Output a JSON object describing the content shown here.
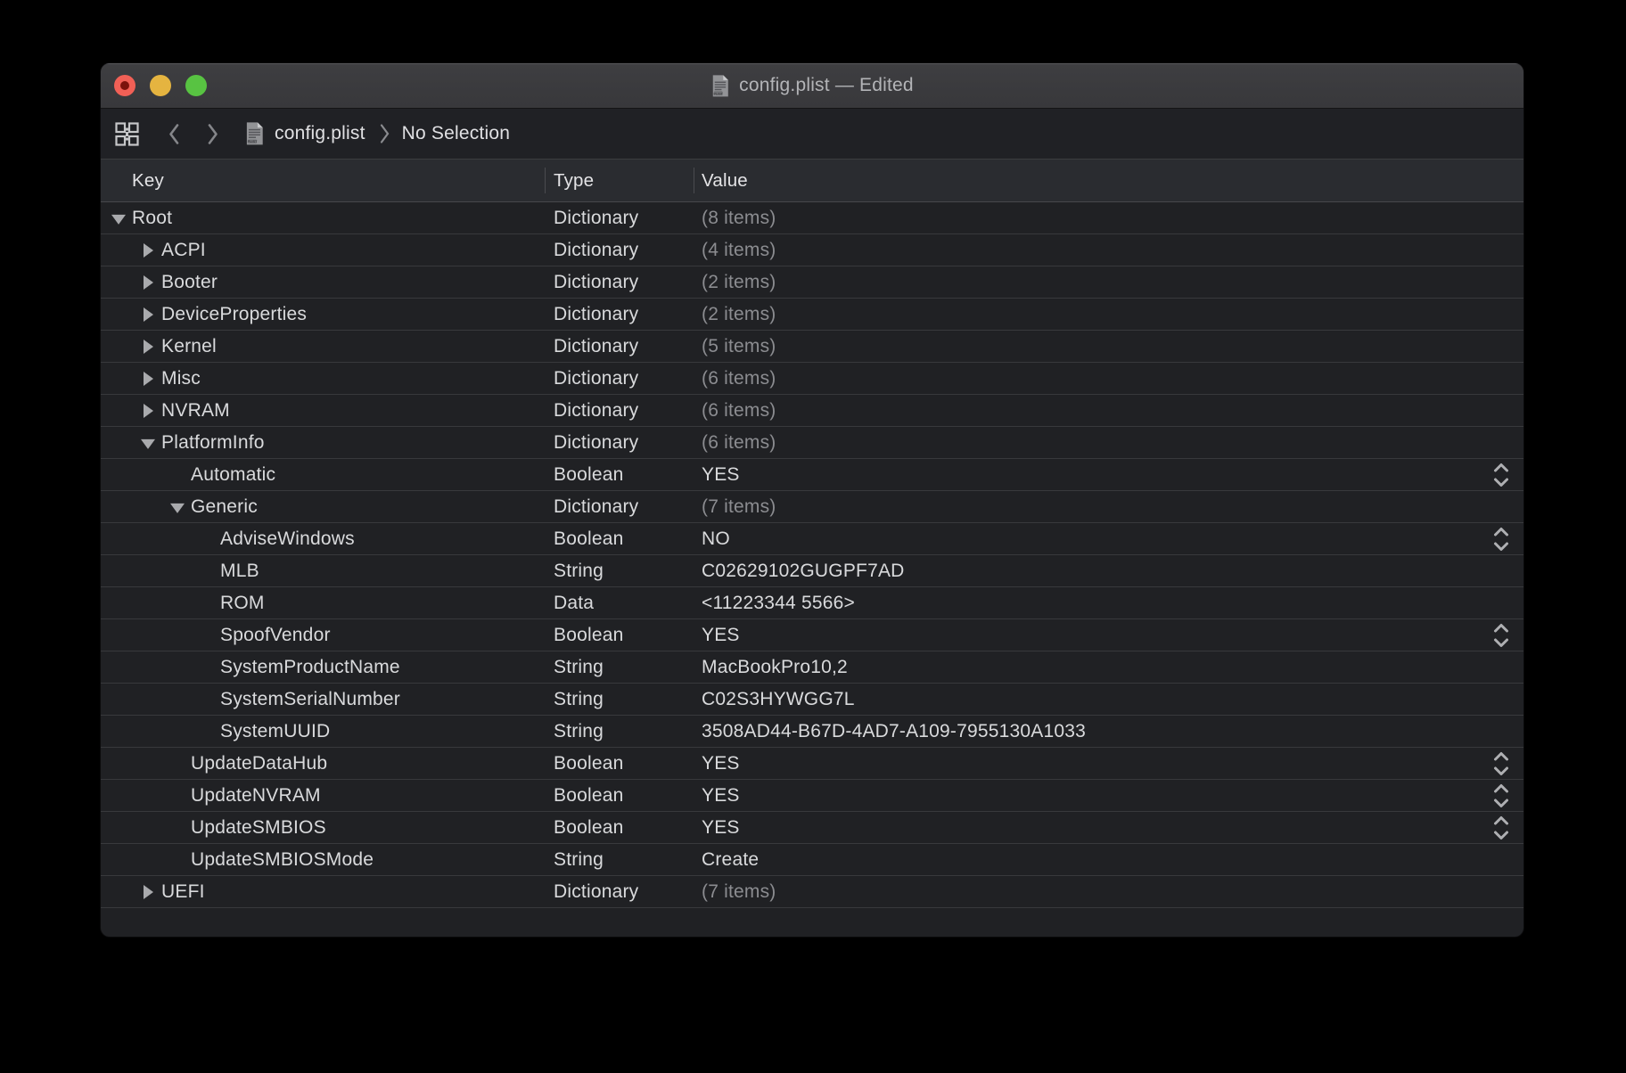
{
  "window": {
    "title": "config.plist — Edited",
    "edited": true
  },
  "breadcrumb": {
    "file": "config.plist",
    "selection": "No Selection"
  },
  "columns": {
    "key": "Key",
    "type": "Type",
    "value": "Value"
  },
  "icons": {
    "titlebar_file_icon": "plist-document-icon",
    "jumpbar_grid_icon": "related-items-grid-icon",
    "back_icon": "chevron-left-icon",
    "forward_icon": "chevron-right-icon",
    "crumb_separator_icon": "chevron-right-thin-icon",
    "boolean_stepper_icon": "up-down-stepper-icon",
    "disclosure_open": "triangle-down-icon",
    "disclosure_closed": "triangle-right-icon"
  },
  "colors": {
    "desktop_background": "#000000",
    "window_background": "#202124",
    "titlebar_background": "#3a3a3d",
    "jumpbar_background": "#202125",
    "header_background": "#2a2c30",
    "row_divider": "#38393c",
    "text_primary": "#d9dadc",
    "text_dim": "#8b8c90",
    "title_text": "#b3b4b7",
    "disclosure_triangle": "#a9aaad",
    "traffic_close": "#f16056",
    "traffic_close_edited_dot": "#7c130c",
    "traffic_minimize": "#e5b440",
    "traffic_zoom": "#58c342"
  },
  "rows": [
    {
      "key": "Root",
      "level": 0,
      "disclosure": "expanded",
      "type": "Dictionary",
      "value": "(8 items)",
      "value_dim": true,
      "stepper": false
    },
    {
      "key": "ACPI",
      "level": 1,
      "disclosure": "collapsed",
      "type": "Dictionary",
      "value": "(4 items)",
      "value_dim": true,
      "stepper": false
    },
    {
      "key": "Booter",
      "level": 1,
      "disclosure": "collapsed",
      "type": "Dictionary",
      "value": "(2 items)",
      "value_dim": true,
      "stepper": false
    },
    {
      "key": "DeviceProperties",
      "level": 1,
      "disclosure": "collapsed",
      "type": "Dictionary",
      "value": "(2 items)",
      "value_dim": true,
      "stepper": false
    },
    {
      "key": "Kernel",
      "level": 1,
      "disclosure": "collapsed",
      "type": "Dictionary",
      "value": "(5 items)",
      "value_dim": true,
      "stepper": false
    },
    {
      "key": "Misc",
      "level": 1,
      "disclosure": "collapsed",
      "type": "Dictionary",
      "value": "(6 items)",
      "value_dim": true,
      "stepper": false
    },
    {
      "key": "NVRAM",
      "level": 1,
      "disclosure": "collapsed",
      "type": "Dictionary",
      "value": "(6 items)",
      "value_dim": true,
      "stepper": false
    },
    {
      "key": "PlatformInfo",
      "level": 1,
      "disclosure": "expanded",
      "type": "Dictionary",
      "value": "(6 items)",
      "value_dim": true,
      "stepper": false
    },
    {
      "key": "Automatic",
      "level": 2,
      "disclosure": "none",
      "type": "Boolean",
      "value": "YES",
      "value_dim": false,
      "stepper": true
    },
    {
      "key": "Generic",
      "level": 2,
      "disclosure": "expanded",
      "type": "Dictionary",
      "value": "(7 items)",
      "value_dim": true,
      "stepper": false
    },
    {
      "key": "AdviseWindows",
      "level": 3,
      "disclosure": "none",
      "type": "Boolean",
      "value": "NO",
      "value_dim": false,
      "stepper": true
    },
    {
      "key": "MLB",
      "level": 3,
      "disclosure": "none",
      "type": "String",
      "value": "C02629102GUGPF7AD",
      "value_dim": false,
      "stepper": false
    },
    {
      "key": "ROM",
      "level": 3,
      "disclosure": "none",
      "type": "Data",
      "value": "<11223344 5566>",
      "value_dim": false,
      "stepper": false
    },
    {
      "key": "SpoofVendor",
      "level": 3,
      "disclosure": "none",
      "type": "Boolean",
      "value": "YES",
      "value_dim": false,
      "stepper": true
    },
    {
      "key": "SystemProductName",
      "level": 3,
      "disclosure": "none",
      "type": "String",
      "value": "MacBookPro10,2",
      "value_dim": false,
      "stepper": false
    },
    {
      "key": "SystemSerialNumber",
      "level": 3,
      "disclosure": "none",
      "type": "String",
      "value": "C02S3HYWGG7L",
      "value_dim": false,
      "stepper": false
    },
    {
      "key": "SystemUUID",
      "level": 3,
      "disclosure": "none",
      "type": "String",
      "value": "3508AD44-B67D-4AD7-A109-7955130A1033",
      "value_dim": false,
      "stepper": false
    },
    {
      "key": "UpdateDataHub",
      "level": 2,
      "disclosure": "none",
      "type": "Boolean",
      "value": "YES",
      "value_dim": false,
      "stepper": true
    },
    {
      "key": "UpdateNVRAM",
      "level": 2,
      "disclosure": "none",
      "type": "Boolean",
      "value": "YES",
      "value_dim": false,
      "stepper": true
    },
    {
      "key": "UpdateSMBIOS",
      "level": 2,
      "disclosure": "none",
      "type": "Boolean",
      "value": "YES",
      "value_dim": false,
      "stepper": true
    },
    {
      "key": "UpdateSMBIOSMode",
      "level": 2,
      "disclosure": "none",
      "type": "String",
      "value": "Create",
      "value_dim": false,
      "stepper": false
    },
    {
      "key": "UEFI",
      "level": 1,
      "disclosure": "collapsed",
      "type": "Dictionary",
      "value": "(7 items)",
      "value_dim": true,
      "stepper": false
    }
  ]
}
